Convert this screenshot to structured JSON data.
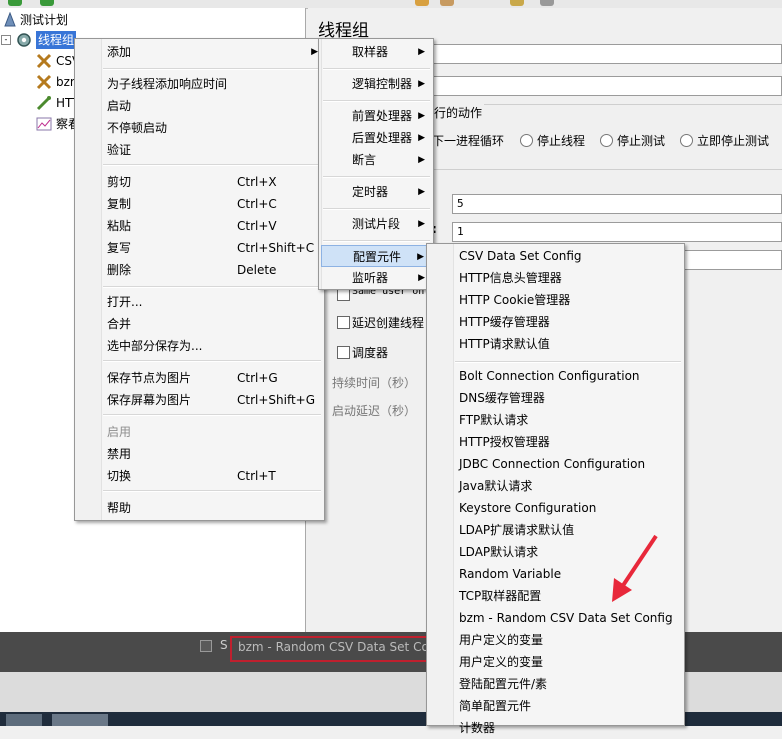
{
  "tree": {
    "root": "测试计划",
    "group": "线程组",
    "children": [
      "CSV",
      "bzm",
      "HTT",
      "察看"
    ]
  },
  "right_panel": {
    "title": "线程组",
    "action_group_title": "行的动作",
    "radio_next_loop": "下一进程循环",
    "radio_stop_thread": "停止线程",
    "radio_stop_test": "停止测试",
    "radio_stop_now": "立即停止测试",
    "threads_value": "5",
    "rampup_value": "1",
    "colon": ":",
    "same_user_partial": "Same user on",
    "delay_create_label": "延迟创建线程",
    "scheduler_label": "调度器",
    "duration_label": "持续时间（秒）",
    "startup_delay_label": "启动延迟（秒）"
  },
  "bottom_strip": {
    "text": "bzm - Random CSV Data Set Conf",
    "prefix": "S"
  },
  "context_menu": {
    "items": [
      {
        "label": "添加",
        "shortcut": "",
        "submenu": true
      },
      {
        "label": "为子线程添加响应时间"
      },
      {
        "label": "启动"
      },
      {
        "label": "不停顿启动"
      },
      {
        "label": "验证"
      },
      {
        "label": "剪切",
        "shortcut": "Ctrl+X"
      },
      {
        "label": "复制",
        "shortcut": "Ctrl+C"
      },
      {
        "label": "粘贴",
        "shortcut": "Ctrl+V"
      },
      {
        "label": "复写",
        "shortcut": "Ctrl+Shift+C"
      },
      {
        "label": "删除",
        "shortcut": "Delete"
      },
      {
        "label": "打开..."
      },
      {
        "label": "合并"
      },
      {
        "label": "选中部分保存为..."
      },
      {
        "label": "保存节点为图片",
        "shortcut": "Ctrl+G"
      },
      {
        "label": "保存屏幕为图片",
        "shortcut": "Ctrl+Shift+G"
      },
      {
        "label": "启用",
        "disabled": true
      },
      {
        "label": "禁用"
      },
      {
        "label": "切换",
        "shortcut": "Ctrl+T"
      },
      {
        "label": "帮助"
      }
    ]
  },
  "add_menu": {
    "items": [
      "取样器",
      "逻辑控制器",
      "前置处理器",
      "后置处理器",
      "断言",
      "定时器",
      "测试片段",
      "配置元件",
      "监听器"
    ],
    "highlighted": "配置元件"
  },
  "config_menu": {
    "items": [
      "CSV Data Set Config",
      "HTTP信息头管理器",
      "HTTP Cookie管理器",
      "HTTP缓存管理器",
      "HTTP请求默认值",
      "Bolt Connection Configuration",
      "DNS缓存管理器",
      "FTP默认请求",
      "HTTP授权管理器",
      "JDBC Connection Configuration",
      "Java默认请求",
      "Keystore Configuration",
      "LDAP扩展请求默认值",
      "LDAP默认请求",
      "Random Variable",
      "TCP取样器配置",
      "bzm - Random CSV Data Set Config",
      "用户定义的变量",
      "用户定义的变量",
      "登陆配置元件/素",
      "简单配置元件",
      "计数器"
    ]
  },
  "colors": {
    "selection": "#3875d7",
    "menu_highlight": "#cfe2f7",
    "arrow": "#e8283a"
  }
}
